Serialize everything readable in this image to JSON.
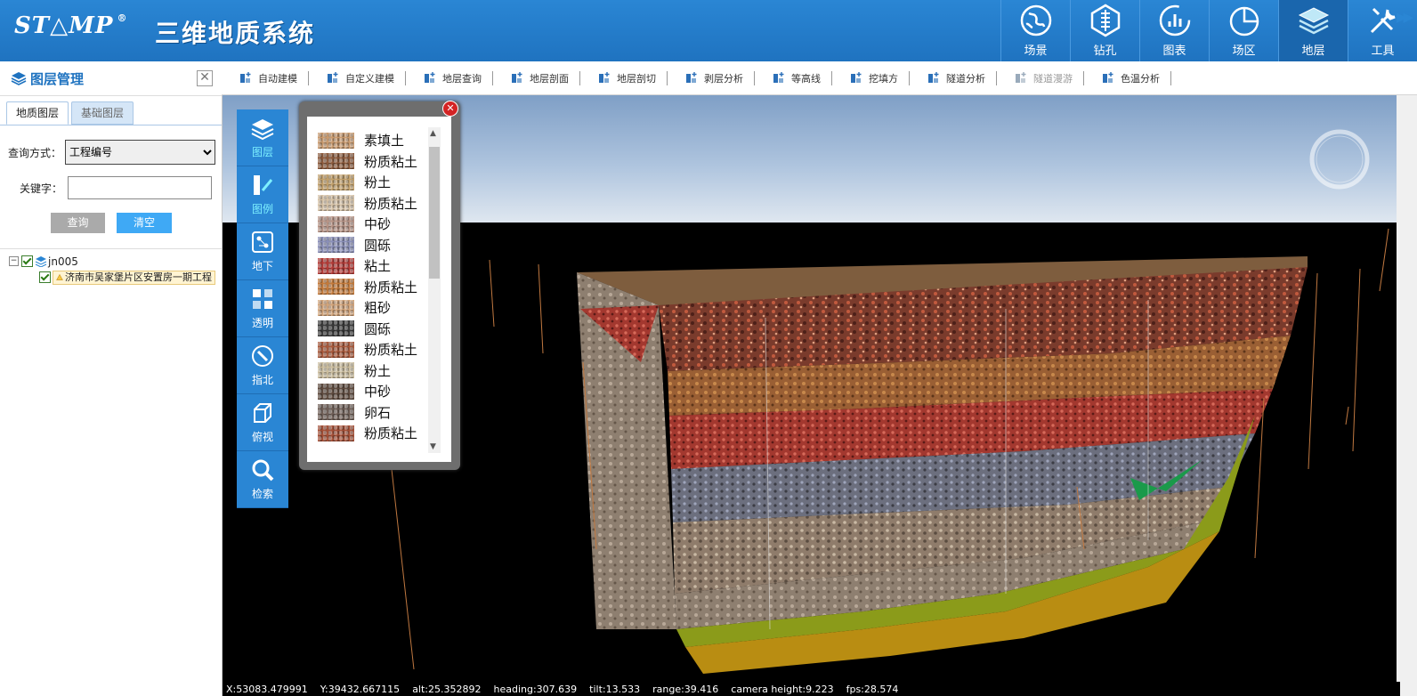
{
  "header": {
    "logo_text": "ST△MP",
    "logo_mark": "®",
    "title": "三维地质系统",
    "nav": [
      {
        "label": "场景",
        "icon": "globe-icon"
      },
      {
        "label": "钻孔",
        "icon": "drill-icon"
      },
      {
        "label": "图表",
        "icon": "chart-icon"
      },
      {
        "label": "场区",
        "icon": "pie-icon"
      },
      {
        "label": "地层",
        "icon": "layers-icon",
        "active": true
      },
      {
        "label": "工具",
        "icon": "tools-icon"
      }
    ]
  },
  "left_panel": {
    "title": "图层管理",
    "close": "✕",
    "tabs": [
      "地质图层",
      "基础图层"
    ],
    "query_label": "查询方式：",
    "query_value": "工程编号",
    "keyword_label": "关键字：",
    "keyword_value": "",
    "query_button": "查询",
    "clear_button": "清空",
    "tree": {
      "root_toggle": "⊟",
      "root_label": "jn005",
      "child_label": "济南市吴家堡片区安置房一期工程"
    }
  },
  "toolbar": {
    "tools": [
      {
        "label": "自动建模",
        "enabled": true
      },
      {
        "label": "自定义建模",
        "enabled": true
      },
      {
        "label": "地层查询",
        "enabled": true
      },
      {
        "label": "地层剖面",
        "enabled": true
      },
      {
        "label": "地层剖切",
        "enabled": true
      },
      {
        "label": "剥层分析",
        "enabled": true
      },
      {
        "label": "等高线",
        "enabled": true
      },
      {
        "label": "挖填方",
        "enabled": true
      },
      {
        "label": "隧道分析",
        "enabled": true
      },
      {
        "label": "隧道漫游",
        "enabled": false
      },
      {
        "label": "色温分析",
        "enabled": true
      }
    ],
    "more": "▶▶"
  },
  "side_tools": [
    {
      "label": "图层",
      "selected": true
    },
    {
      "label": "图例",
      "selected": true
    },
    {
      "label": "地下",
      "selected": false
    },
    {
      "label": "透明",
      "selected": false
    },
    {
      "label": "指北",
      "selected": false
    },
    {
      "label": "俯视",
      "selected": false
    },
    {
      "label": "检索",
      "selected": false
    }
  ],
  "legend": {
    "close": "✕",
    "items": [
      {
        "label": "素填土",
        "color": "#c99a6e"
      },
      {
        "label": "粉质粘土",
        "color": "#8c5a3c"
      },
      {
        "label": "粉土",
        "color": "#c2a06b"
      },
      {
        "label": "粉质粘土",
        "color": "#d6c2a6"
      },
      {
        "label": "中砂",
        "color": "#b79486"
      },
      {
        "label": "圆砾",
        "color": "#8a8fb8"
      },
      {
        "label": "粘土",
        "color": "#b33a36"
      },
      {
        "label": "粉质粘土",
        "color": "#c47a3a"
      },
      {
        "label": "粗砂",
        "color": "#d2a47a"
      },
      {
        "label": "圆砾",
        "color": "#3a3a3a"
      },
      {
        "label": "粉质粘土",
        "color": "#a8583a"
      },
      {
        "label": "粉土",
        "color": "#cbbd9e"
      },
      {
        "label": "中砂",
        "color": "#5e4a3e"
      },
      {
        "label": "卵石",
        "color": "#6e5e56"
      },
      {
        "label": "粉质粘土",
        "color": "#a44e35"
      }
    ]
  },
  "status": {
    "x": "X:53083.479991",
    "y": "Y:39432.667115",
    "alt": "alt:25.352892",
    "heading": "heading:307.639",
    "tilt": "tilt:13.533",
    "range": "range:39.416",
    "camera_height": "camera height:9.223",
    "fps": "fps:28.574"
  }
}
